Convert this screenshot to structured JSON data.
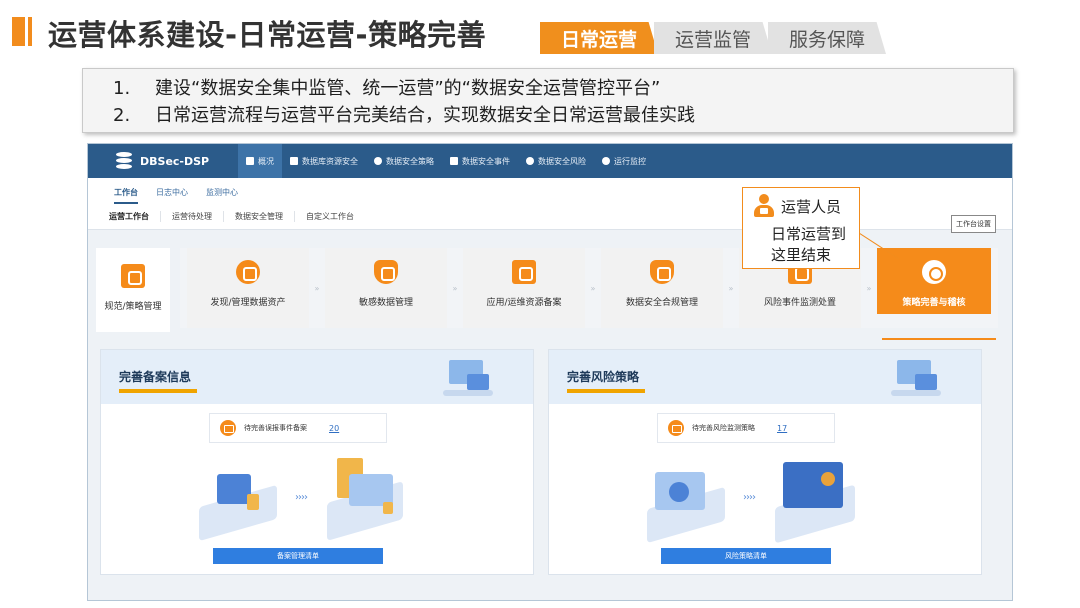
{
  "slide": {
    "title": "运营体系建设-日常运营-策略完善",
    "tabs": [
      {
        "label": "日常运营",
        "active": true
      },
      {
        "label": "运营监管",
        "active": false
      },
      {
        "label": "服务保障",
        "active": false
      }
    ],
    "points": [
      {
        "num": "1.",
        "text": "建设“数据安全集中监管、统一运营”的“数据安全运营管控平台”"
      },
      {
        "num": "2.",
        "text": "日常运营流程与运营平台完美结合，实现数据安全日常运营最佳实践"
      }
    ],
    "accent_color": "#f28c1d"
  },
  "app": {
    "brand": "DBSec-DSP",
    "nav": [
      {
        "label": "概况",
        "icon": "overview-icon",
        "active": true
      },
      {
        "label": "数据库资源安全",
        "icon": "monitor-icon"
      },
      {
        "label": "数据安全策略",
        "icon": "target-icon"
      },
      {
        "label": "数据安全事件",
        "icon": "events-icon"
      },
      {
        "label": "数据安全风险",
        "icon": "gear-icon"
      },
      {
        "label": "运行监控",
        "icon": "gear-icon"
      }
    ],
    "subnav": [
      {
        "label": "工作台",
        "active": true
      },
      {
        "label": "日志中心"
      },
      {
        "label": "监测中心"
      }
    ],
    "work_tabs": [
      {
        "label": "运营工作台",
        "active": true
      },
      {
        "label": "运营待处理"
      },
      {
        "label": "数据安全管理"
      },
      {
        "label": "自定义工作台"
      }
    ],
    "workspace_setting": "工作台设置",
    "flow": {
      "first": {
        "label": "规范/策略管理",
        "icon": "policy-icon"
      },
      "steps": [
        {
          "label": "发现/管理数据资产",
          "icon": "asset-discovery-icon"
        },
        {
          "label": "敏感数据管理",
          "icon": "sensitive-data-icon"
        },
        {
          "label": "应用/运维资源备案",
          "icon": "resource-filing-icon"
        },
        {
          "label": "数据安全合规管理",
          "icon": "compliance-icon"
        },
        {
          "label": "风险事件监测处置",
          "icon": "risk-monitor-icon"
        },
        {
          "label": "策略完善与稽核",
          "icon": "policy-audit-icon",
          "highlight": true
        }
      ]
    },
    "panels": [
      {
        "title": "完善备案信息",
        "todo_label": "待完善误报事件备案",
        "todo_count": "20",
        "button": "备案管理清单"
      },
      {
        "title": "完善风险策略",
        "todo_label": "待完善风险监测策略",
        "todo_count": "17",
        "button": "风险策略清单"
      }
    ],
    "colors": {
      "topbar": "#2b5b8a",
      "highlight": "#f58b1a",
      "button": "#2f7ee0"
    }
  },
  "callout": {
    "role": "运营人员",
    "line1": "日常运营到",
    "line2": "这里结束"
  }
}
